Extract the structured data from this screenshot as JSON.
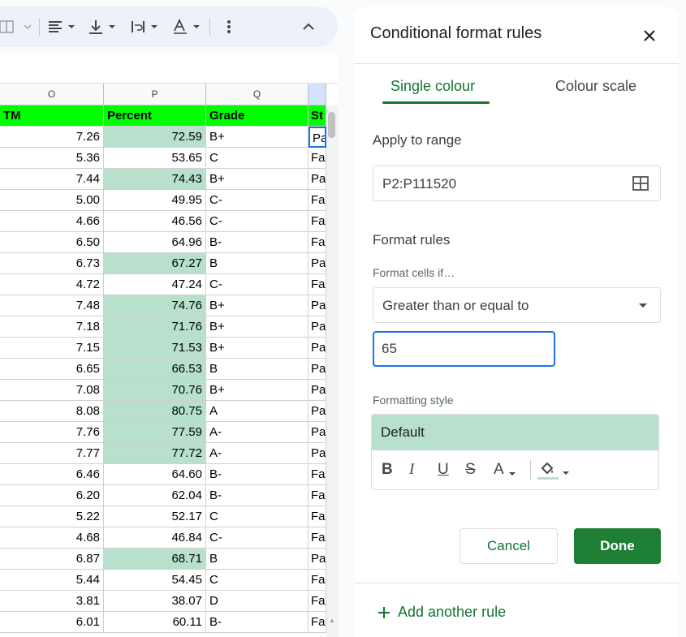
{
  "sheet": {
    "columns": [
      {
        "letter": "O",
        "header": "TM"
      },
      {
        "letter": "P",
        "header": "Percent"
      },
      {
        "letter": "Q",
        "header": "Grade"
      },
      {
        "letter": "",
        "header": "St"
      }
    ],
    "rows": [
      {
        "tm": "7.26",
        "percent": "72.59",
        "grade": "B+",
        "status": "Pa",
        "highlight": true
      },
      {
        "tm": "5.36",
        "percent": "53.65",
        "grade": "C",
        "status": "Fa",
        "highlight": false
      },
      {
        "tm": "7.44",
        "percent": "74.43",
        "grade": "B+",
        "status": "Pa",
        "highlight": true
      },
      {
        "tm": "5.00",
        "percent": "49.95",
        "grade": "C-",
        "status": "Fa",
        "highlight": false
      },
      {
        "tm": "4.66",
        "percent": "46.56",
        "grade": "C-",
        "status": "Fa",
        "highlight": false
      },
      {
        "tm": "6.50",
        "percent": "64.96",
        "grade": "B-",
        "status": "Fa",
        "highlight": false
      },
      {
        "tm": "6.73",
        "percent": "67.27",
        "grade": "B",
        "status": "Pa",
        "highlight": true
      },
      {
        "tm": "4.72",
        "percent": "47.24",
        "grade": "C-",
        "status": "Fa",
        "highlight": false
      },
      {
        "tm": "7.48",
        "percent": "74.76",
        "grade": "B+",
        "status": "Pa",
        "highlight": true
      },
      {
        "tm": "7.18",
        "percent": "71.76",
        "grade": "B+",
        "status": "Pa",
        "highlight": true
      },
      {
        "tm": "7.15",
        "percent": "71.53",
        "grade": "B+",
        "status": "Pa",
        "highlight": true
      },
      {
        "tm": "6.65",
        "percent": "66.53",
        "grade": "B",
        "status": "Pa",
        "highlight": true
      },
      {
        "tm": "7.08",
        "percent": "70.76",
        "grade": "B+",
        "status": "Pa",
        "highlight": true
      },
      {
        "tm": "8.08",
        "percent": "80.75",
        "grade": "A",
        "status": "Pa",
        "highlight": true
      },
      {
        "tm": "7.76",
        "percent": "77.59",
        "grade": "A-",
        "status": "Pa",
        "highlight": true
      },
      {
        "tm": "7.77",
        "percent": "77.72",
        "grade": "A-",
        "status": "Pa",
        "highlight": true
      },
      {
        "tm": "6.46",
        "percent": "64.60",
        "grade": "B-",
        "status": "Fa",
        "highlight": false
      },
      {
        "tm": "6.20",
        "percent": "62.04",
        "grade": "B-",
        "status": "Fa",
        "highlight": false
      },
      {
        "tm": "5.22",
        "percent": "52.17",
        "grade": "C",
        "status": "Fa",
        "highlight": false
      },
      {
        "tm": "4.68",
        "percent": "46.84",
        "grade": "C-",
        "status": "Fa",
        "highlight": false
      },
      {
        "tm": "6.87",
        "percent": "68.71",
        "grade": "B",
        "status": "Pa",
        "highlight": true
      },
      {
        "tm": "5.44",
        "percent": "54.45",
        "grade": "C",
        "status": "Fa",
        "highlight": false
      },
      {
        "tm": "3.81",
        "percent": "38.07",
        "grade": "D",
        "status": "Fa",
        "highlight": false
      },
      {
        "tm": "6.01",
        "percent": "60.11",
        "grade": "B-",
        "status": "Fa",
        "highlight": false
      }
    ]
  },
  "toolbar": {
    "icons": [
      "merge-cells-icon",
      "align-left-icon",
      "vertical-align-bottom-icon",
      "text-wrap-icon",
      "text-rotation-icon",
      "more-vert-icon",
      "chevron-up-icon"
    ]
  },
  "panel": {
    "title": "Conditional format rules",
    "tabs": {
      "single": "Single colour",
      "scale": "Colour scale"
    },
    "apply_to_range": {
      "label": "Apply to range",
      "value": "P2:P111520"
    },
    "format_rules": {
      "label": "Format rules",
      "condition_label": "Format cells if…",
      "condition": "Greater than or equal to",
      "value": "65"
    },
    "formatting_style": {
      "label": "Formatting style",
      "preview": "Default",
      "bold": "B",
      "italic": "I",
      "underline": "U",
      "strikethrough": "S",
      "text_colour": "A"
    },
    "buttons": {
      "cancel": "Cancel",
      "done": "Done"
    },
    "add_rule": "Add another rule"
  },
  "colors": {
    "accent_green": "#137333",
    "done_green": "#1e7e34",
    "highlight_fill": "#b7e1cd",
    "header_fill": "#00ff00",
    "focus_blue": "#1a73e8"
  }
}
